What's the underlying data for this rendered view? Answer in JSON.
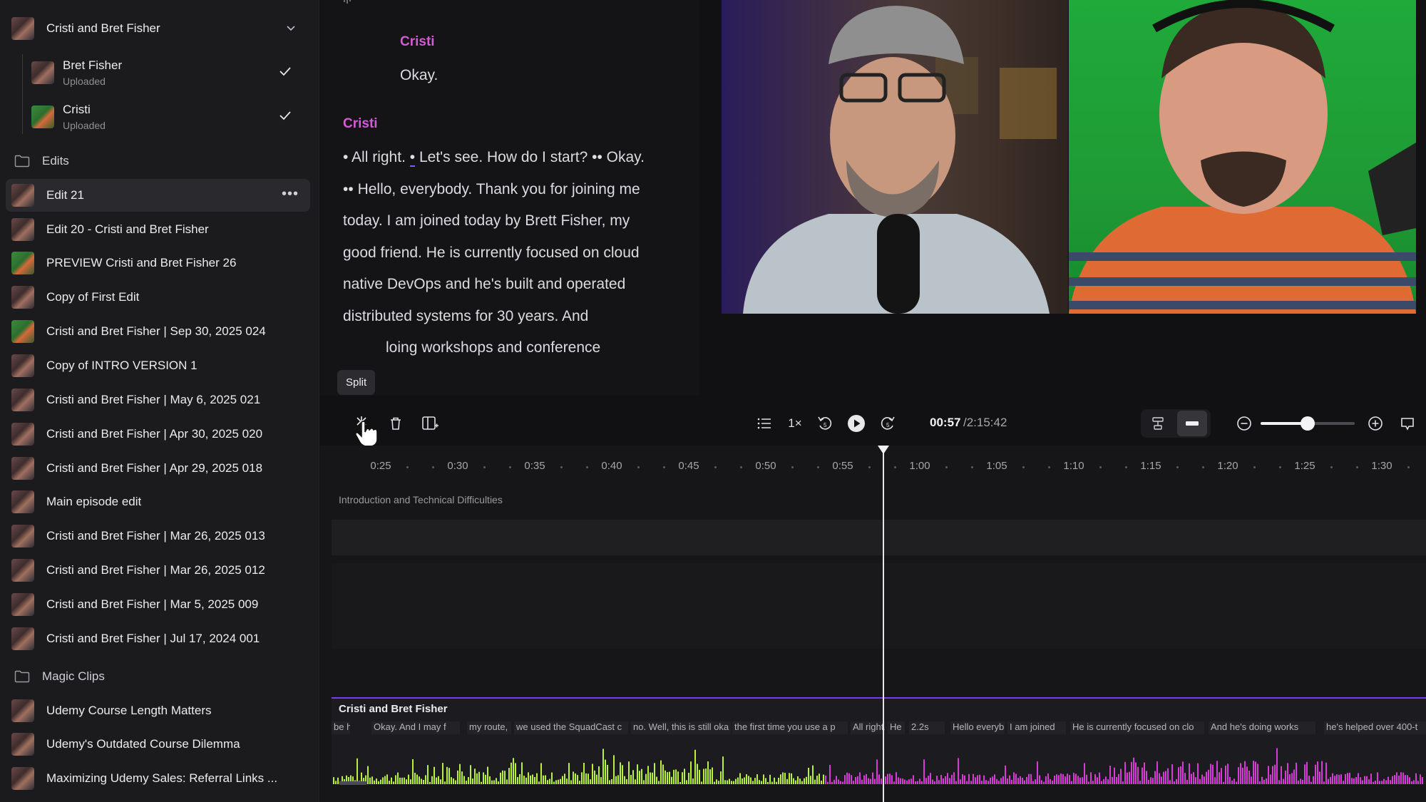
{
  "sidebar": {
    "group": {
      "title": "Cristi and Bret Fisher"
    },
    "tracks": [
      {
        "name": "Bret Fisher",
        "status": "Uploaded"
      },
      {
        "name": "Cristi",
        "status": "Uploaded"
      }
    ],
    "edits_folder": "Edits",
    "edits": [
      "Edit 21",
      "Edit 20 - Cristi and Bret Fisher",
      "PREVIEW Cristi and Bret Fisher 26",
      "Copy of First Edit",
      "Cristi and Bret Fisher | Sep 30, 2025 024",
      "Copy of INTRO VERSION 1",
      "Cristi and Bret Fisher | May 6, 2025 021",
      "Cristi and Bret Fisher | Apr 30, 2025 020",
      "Cristi and Bret Fisher | Apr 29, 2025 018",
      "Main episode edit",
      "Cristi and Bret Fisher | Mar 26, 2025 013",
      "Cristi and Bret Fisher | Mar 26, 2025 012",
      "Cristi and Bret Fisher | Mar 5, 2025 009",
      "Cristi and Bret Fisher | Jul 17, 2024 001"
    ],
    "clips_folder": "Magic Clips",
    "clips": [
      "Udemy Course Length Matters",
      "Udemy's Outdated Course Dilemma",
      "Maximizing Udemy Sales: Referral Links ..."
    ]
  },
  "transcript": {
    "speaker1": "Cristi",
    "line1": "Okay.",
    "speaker2": "Cristi",
    "para": {
      "a": "All right.",
      "b": "Let's see. How do I start?",
      "c": "Okay.",
      "d": "Hello, everybody. Thank you for joining me today. I am joined today by Brett Fisher, my good friend. He is currently focused on cloud native DevOps and he's built and operated distributed systems for 30 years. And",
      "e": "loing workshops and conference"
    }
  },
  "tooltip": "Split",
  "toolbar": {
    "speed": "1×",
    "time_current": "00:57",
    "time_total": "/2:15:42",
    "zoom_level": 0.5
  },
  "timeline": {
    "ticks": [
      "0:25",
      "0:30",
      "0:35",
      "0:40",
      "0:45",
      "0:50",
      "0:55",
      "1:00",
      "1:05",
      "1:10",
      "1:15",
      "1:20",
      "1:25",
      "1:30"
    ],
    "chapter": "Introduction and Technical Difficulties",
    "track_name": "Cristi and Bret Fisher",
    "segments": [
      "be h",
      "Okay. And I may f",
      "my route,",
      "we used the SquadCast c",
      "no. Well, this is still oka",
      "the first time you use a p",
      "All right.",
      "He",
      "2.2s",
      "Hello everyb",
      "I am joined",
      "He is currently focused on clo",
      "And he's doing works",
      "he's helped over 400-t"
    ],
    "colors": {
      "left_wave": "#b8f03a",
      "right_wave": "#d63cd6",
      "accent": "#7a3cf0"
    }
  }
}
